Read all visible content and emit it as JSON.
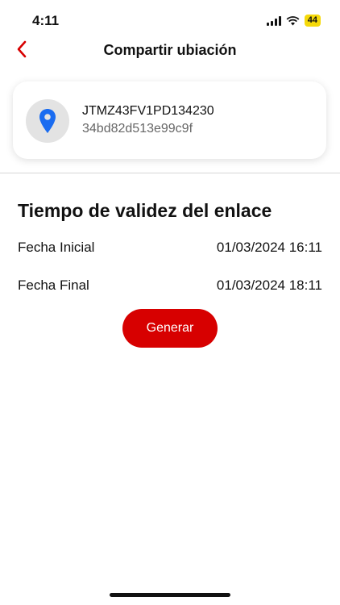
{
  "status_bar": {
    "time": "4:11",
    "battery": "44"
  },
  "header": {
    "title": "Compartir ubiación",
    "back_icon": "chevron-left-icon",
    "accent_color": "#d70000"
  },
  "vehicle": {
    "icon": "location-pin-icon",
    "vin": "JTMZ43FV1PD134230",
    "device_id": "34bd82d513e99c9f"
  },
  "validity": {
    "title": "Tiempo de validez del enlace",
    "start_label": "Fecha Inicial",
    "start_value": "01/03/2024 16:11",
    "end_label": "Fecha Final",
    "end_value": "01/03/2024 18:11"
  },
  "actions": {
    "generate_label": "Generar"
  }
}
